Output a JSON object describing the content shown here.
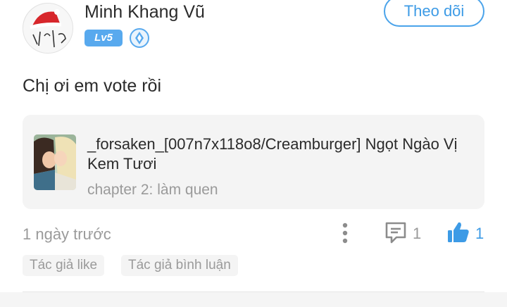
{
  "user": {
    "name": "Minh Khang Vũ",
    "level": "Lv5",
    "follow_label": "Theo dõi"
  },
  "comment": {
    "text": "Chị ơi em vote rồi",
    "timestamp": "1 ngày trước",
    "reply_count": "1",
    "like_count": "1"
  },
  "story": {
    "title": "_forsaken_[007n7x118o8/Creamburger] Ngọt Ngào Vị Kem Tươi",
    "chapter": "chapter 2: làm quen"
  },
  "tags": [
    "Tác giả like",
    "Tác giả bình luận"
  ],
  "colors": {
    "accent": "#3d9be6",
    "level_badge": "#58a9ee",
    "muted_text": "#9a9a9a",
    "card_bg": "#f4f4f4"
  },
  "icons": {
    "rank": "rank-diamond-icon",
    "more": "more-vertical-icon",
    "comment": "comment-icon",
    "like": "thumbs-up-icon"
  }
}
